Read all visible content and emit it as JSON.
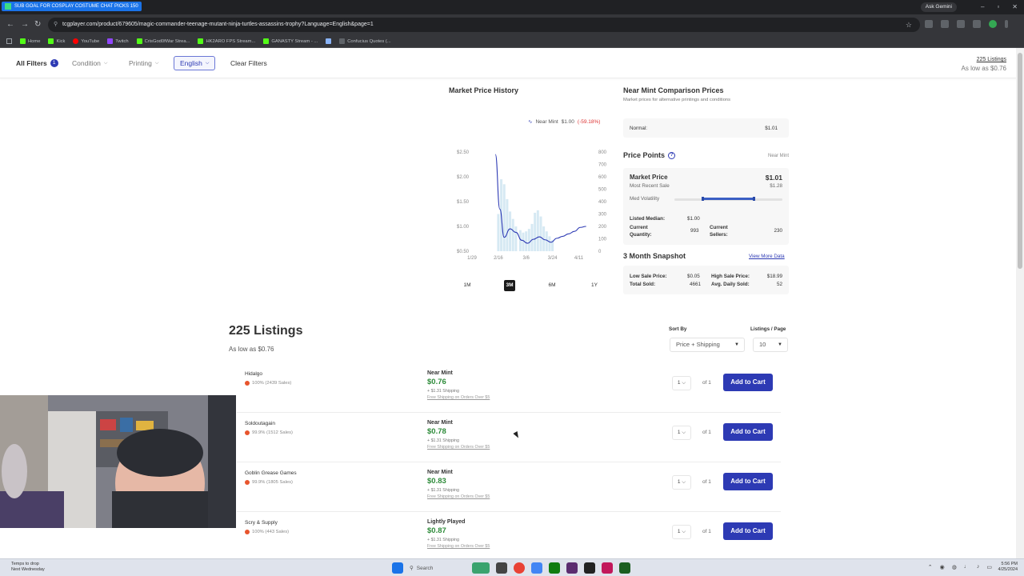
{
  "browser": {
    "tab_title": "SUB GOAL FOR COSPLAY COSTUME CHAT PICKS   150",
    "gemini_label": "Ask Gemini",
    "url": "tcgplayer.com/product/679605/magic-commander-teenage-mutant-ninja-turtles-assassins-trophy?Language=English&page=1",
    "bookmarks": [
      "Home",
      "Kick",
      "YouTube",
      "Twitch",
      "CrisGod0fWar Strea...",
      "HK2ARO FPS Stream...",
      "GANASTY Stream - ...",
      "",
      "Confucius Quotes (..."
    ]
  },
  "filters": {
    "all_filters": "All Filters",
    "all_filters_count": "1",
    "condition": "Condition",
    "printing": "Printing",
    "language": "English",
    "clear": "Clear Filters",
    "listings_count_link": "225 Listings",
    "as_low_as": "As low as $0.76"
  },
  "market_history": {
    "title": "Market Price History",
    "legend_label": "Near Mint",
    "legend_price": "$1.00",
    "legend_change": "(-59.18%)",
    "ranges": [
      "1M",
      "3M",
      "6M",
      "1Y"
    ],
    "active_range": "3M"
  },
  "chart_data": {
    "type": "line",
    "x_ticks": [
      "1/29",
      "2/16",
      "3/6",
      "3/24",
      "4/11"
    ],
    "y_left_ticks": [
      "$2.50",
      "$2.00",
      "$1.50",
      "$1.00",
      "$0.50"
    ],
    "y_right_ticks": [
      "800",
      "700",
      "600",
      "500",
      "400",
      "300",
      "200",
      "100",
      "0"
    ],
    "ylim_price": [
      0.5,
      2.5
    ],
    "ylim_volume": [
      0,
      800
    ],
    "series": [
      {
        "name": "Near Mint",
        "x": [
          "2/14",
          "2/17",
          "2/20",
          "2/24",
          "2/28",
          "3/3",
          "3/7",
          "3/11",
          "3/15",
          "3/19",
          "3/23",
          "3/27",
          "3/31",
          "4/4",
          "4/8",
          "4/12",
          "4/16"
        ],
        "values": [
          2.45,
          1.35,
          0.78,
          0.95,
          0.88,
          0.72,
          0.66,
          0.74,
          0.79,
          0.73,
          0.68,
          0.76,
          0.8,
          0.85,
          0.9,
          0.98,
          1.0
        ]
      }
    ],
    "volume_bars": {
      "x": [
        "2/16",
        "2/18",
        "2/20",
        "2/22",
        "2/24",
        "2/26",
        "2/28",
        "3/2",
        "3/4",
        "3/6",
        "3/8",
        "3/10",
        "3/12",
        "3/14",
        "3/16",
        "3/18",
        "3/20",
        "3/22",
        "3/24"
      ],
      "values": [
        300,
        580,
        540,
        420,
        320,
        260,
        200,
        170,
        150,
        160,
        180,
        220,
        310,
        330,
        280,
        200,
        160,
        120,
        90
      ]
    }
  },
  "comparison": {
    "title": "Near Mint Comparison Prices",
    "subtitle": "Market prices for alternative printings and conditions",
    "normal_label": "Normal:",
    "normal_value": "$1.01"
  },
  "price_points": {
    "title": "Price Points",
    "condition_label": "Near Mint",
    "market_price_label": "Market Price",
    "market_price_value": "$1.01",
    "most_recent_label": "Most Recent Sale",
    "most_recent_value": "$1.28",
    "volatility_label": "Med Volatility",
    "volatility_low": 0.25,
    "volatility_high": 0.75,
    "listed_median_label": "Listed Median:",
    "listed_median_value": "$1.00",
    "current_quantity_label_1": "Current",
    "current_quantity_label_2": "Quantity:",
    "current_quantity_value": "993",
    "current_sellers_label_1": "Current",
    "current_sellers_label_2": "Sellers:",
    "current_sellers_value": "230"
  },
  "snapshot": {
    "title": "3 Month Snapshot",
    "more_link": "View More Data",
    "low_sale_label": "Low Sale Price:",
    "low_sale_value": "$0.05",
    "high_sale_label": "High Sale Price:",
    "high_sale_value": "$18.99",
    "total_sold_label": "Total Sold:",
    "total_sold_value": "4661",
    "avg_daily_label": "Avg. Daily Sold:",
    "avg_daily_value": "52"
  },
  "listings": {
    "title": "225 Listings",
    "as_low_as": "As low as $0.76",
    "sort_label": "Sort By",
    "sort_value": "Price + Shipping",
    "per_page_label": "Listings / Page",
    "per_page_value": "10",
    "items": [
      {
        "seller": "Hidalgo",
        "stats": "100% (2439 Sales)",
        "condition": "Near Mint",
        "price": "$0.76",
        "shipping": "+ $1.31 Shipping",
        "free_ship": "Free Shipping on Orders Over $5",
        "qty": "1",
        "of": "of 1",
        "cta": "Add to Cart"
      },
      {
        "seller": "Soldoutagain",
        "stats": "99.9% (1512 Sales)",
        "condition": "Near Mint",
        "price": "$0.78",
        "shipping": "+ $1.31 Shipping",
        "free_ship": "Free Shipping on Orders Over $5",
        "qty": "1",
        "of": "of 1",
        "cta": "Add to Cart"
      },
      {
        "seller": "Goblin Grease Games",
        "stats": "99.9% (1805 Sales)",
        "condition": "Near Mint",
        "price": "$0.83",
        "shipping": "+ $1.31 Shipping",
        "free_ship": "Free Shipping on Orders Over $5",
        "qty": "1",
        "of": "of 1",
        "cta": "Add to Cart"
      },
      {
        "seller": "Scry & Supply",
        "stats": "100% (443 Sales)",
        "condition": "Lightly Played",
        "price": "$0.87",
        "shipping": "+ $1.31 Shipping",
        "free_ship": "Free Shipping on Orders Over $5",
        "qty": "1",
        "of": "of 1",
        "cta": "Add to Cart"
      }
    ]
  },
  "taskbar": {
    "weather_line1": "Temps to drop",
    "weather_line2": "Next Wednesday",
    "search_label": "Search",
    "time": "5:56 PM",
    "date": "4/25/2024"
  },
  "colors": {
    "accent": "#2d3ab4",
    "price_green": "#2e8b3a",
    "chart_line": "#2d3ab4",
    "volume_bar": "#d6e9f3"
  }
}
